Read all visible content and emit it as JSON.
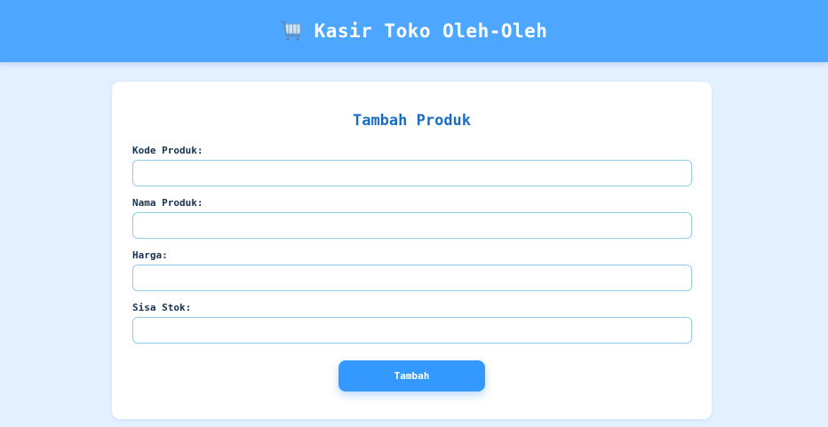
{
  "header": {
    "icon": "shopping-cart-icon",
    "title": "Kasir Toko Oleh-Oleh",
    "background": "#4da6ff"
  },
  "form": {
    "title": "Tambah Produk",
    "fields": [
      {
        "label": "Kode Produk:",
        "value": "",
        "placeholder": ""
      },
      {
        "label": "Nama Produk:",
        "value": "",
        "placeholder": ""
      },
      {
        "label": "Harga:",
        "value": "",
        "placeholder": ""
      },
      {
        "label": "Sisa Stok:",
        "value": "",
        "placeholder": ""
      }
    ],
    "submit_label": "Tambah",
    "accent": "#3399ff"
  }
}
